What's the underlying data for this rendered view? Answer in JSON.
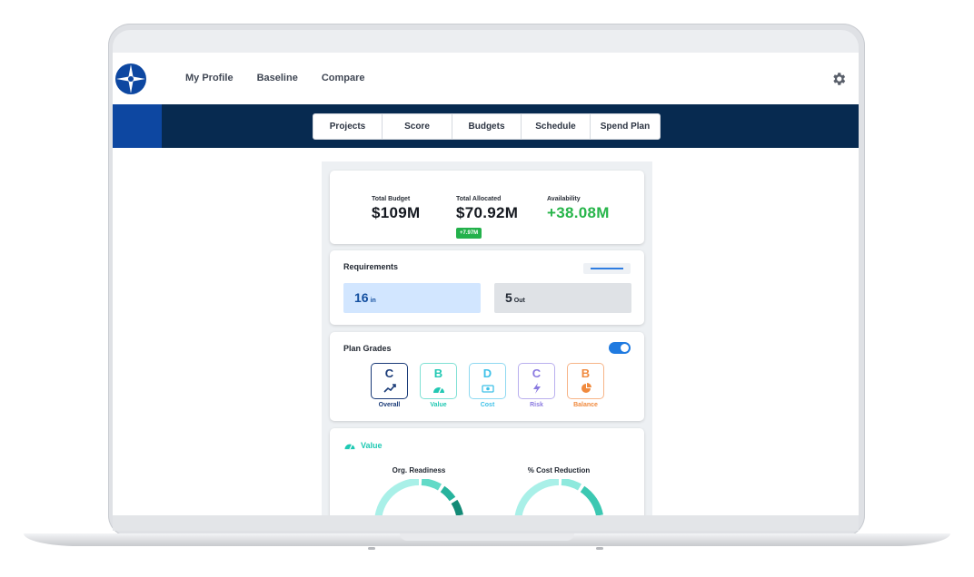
{
  "nav": {
    "items": [
      "My Profile",
      "Baseline",
      "Compare"
    ]
  },
  "tabs": [
    "Projects",
    "Score",
    "Budgets",
    "Schedule",
    "Spend Plan"
  ],
  "budget": {
    "total_label": "Total Budget",
    "total_value": "$109M",
    "allocated_label": "Total Allocated",
    "allocated_value": "$70.92M",
    "allocated_badge": "+7.97M",
    "availability_label": "Availability",
    "availability_value": "+38.08M"
  },
  "requirements": {
    "title": "Requirements",
    "in_count": "16",
    "in_label": "in",
    "out_count": "5",
    "out_label": "Out"
  },
  "plan_grades": {
    "title": "Plan Grades",
    "toggle_on": true,
    "grades": [
      {
        "label": "Overall",
        "grade": "C",
        "color": "#1a3b78",
        "icon": "trend-up-icon"
      },
      {
        "label": "Value",
        "grade": "B",
        "color": "#22c8b3",
        "icon": "gauge-icon"
      },
      {
        "label": "Cost",
        "grade": "D",
        "color": "#3fc1e8",
        "icon": "money-icon"
      },
      {
        "label": "Risk",
        "grade": "C",
        "color": "#8a7ae0",
        "icon": "lightning-icon"
      },
      {
        "label": "Balance",
        "grade": "B",
        "color": "#f08a3e",
        "icon": "pie-icon"
      }
    ]
  },
  "value_section": {
    "title": "Value",
    "gauges": [
      "Org. Readiness",
      "% Cost Reduction"
    ]
  },
  "colors": {
    "navy_band": "#072a50",
    "brand_blue": "#0d47a1",
    "positive_green": "#27b54a",
    "teal": "#1fc9b3"
  }
}
